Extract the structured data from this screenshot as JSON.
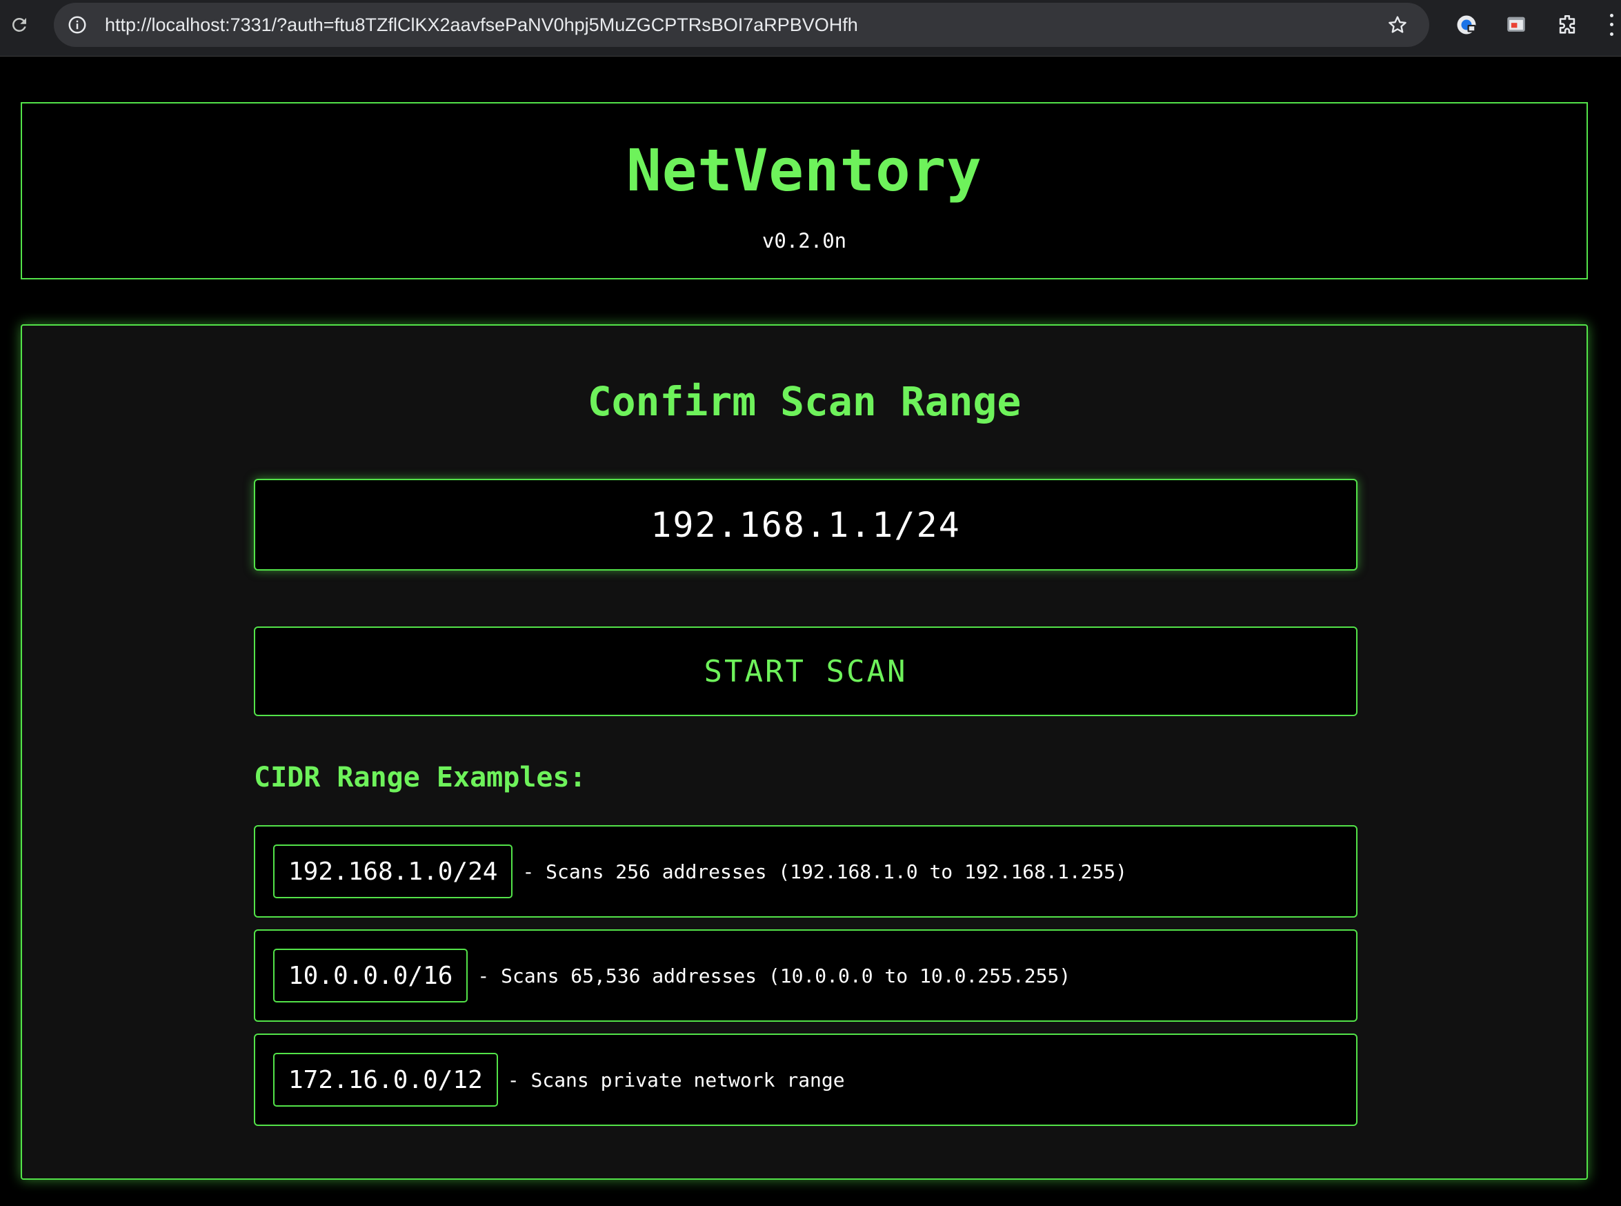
{
  "browser": {
    "url": "http://localhost:7331/?auth=ftu8TZflClKX2aavfsePaNV0hpj5MuZGCPTRsBOI7aRPBVOHfh",
    "icons": [
      "reload-icon",
      "site-info-icon",
      "bookmark-star-icon",
      "profile-extension-icon",
      "cast-extension-icon",
      "extensions-puzzle-icon"
    ]
  },
  "header": {
    "title": "NetVentory",
    "version": "v0.2.0n"
  },
  "scan": {
    "title": "Confirm Scan Range",
    "range_value": "192.168.1.1/24",
    "start_label": "START SCAN"
  },
  "examples": {
    "heading": "CIDR Range Examples:",
    "items": [
      {
        "cidr": "192.168.1.0/24",
        "description": "- Scans 256 addresses (192.168.1.0 to 192.168.1.255)"
      },
      {
        "cidr": "10.0.0.0/16",
        "description": "- Scans 65,536 addresses (10.0.0.0 to 10.0.255.255)"
      },
      {
        "cidr": "172.16.0.0/12",
        "description": "- Scans private network range"
      }
    ]
  },
  "colors": {
    "accent_green": "#6ef25b",
    "border_green": "#53e349",
    "background": "#000000",
    "panel": "#111111",
    "text": "#ffffff"
  }
}
